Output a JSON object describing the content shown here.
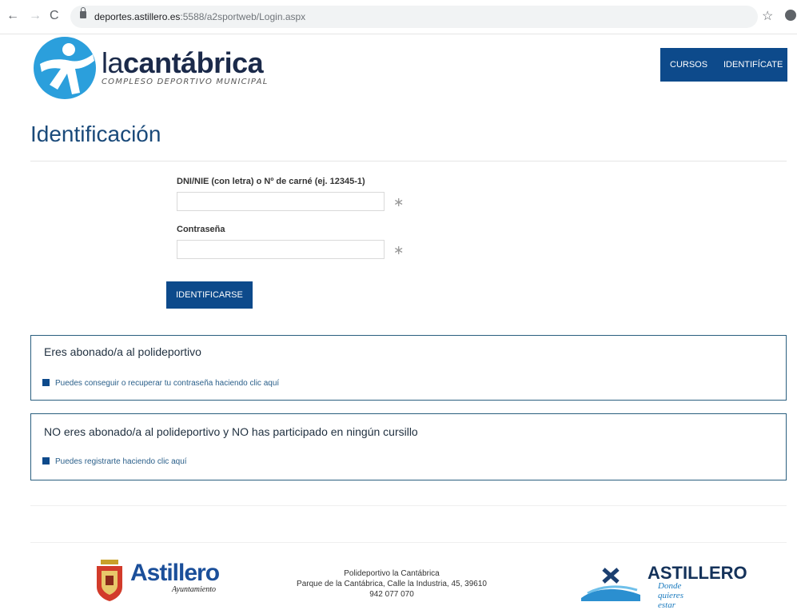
{
  "browser": {
    "url_host": "deportes.astillero.es",
    "url_path": ":5588/a2sportweb/Login.aspx"
  },
  "header": {
    "brand_prefix": "la",
    "brand_name": "cantábrica",
    "brand_subtitle": "COMPLESO DEPORTIVO MUNICIPAL",
    "nav": [
      "CURSOS",
      "IDENTIFÍCATE"
    ]
  },
  "page": {
    "title": "Identificación"
  },
  "form": {
    "user_label": "DNI/NIE (con letra) o Nº de carné (ej. 12345-1)",
    "user_value": "",
    "password_label": "Contraseña",
    "password_value": "",
    "required_mark": "∗",
    "submit_label": "IDENTIFICARSE"
  },
  "panels": [
    {
      "title": "Eres abonado/a al polideportivo",
      "link": "Puedes conseguir o recuperar tu contraseña haciendo clic aquí"
    },
    {
      "title": "NO eres abonado/a al polideportivo y NO has participado en ningún cursillo",
      "link": "Puedes registrarte haciendo clic aquí"
    }
  ],
  "footer": {
    "left_logo_text": "Astillero",
    "left_logo_sub": "Ayuntamiento",
    "address_lines": [
      "Polideportivo la Cantábrica",
      "Parque de la Cantábrica, Calle la Industria, 45, 39610",
      "942 077 070"
    ],
    "right_logo_text": "ASTILLERO",
    "right_logo_tagline": "Donde quieres estar"
  },
  "colors": {
    "primary": "#0d4a8b",
    "title": "#1a4a7a",
    "panel_border": "#2a5f7f",
    "logo_blue": "#2b9fdc"
  },
  "icons": [
    "back-arrow-icon",
    "forward-arrow-icon",
    "reload-icon",
    "lock-icon",
    "star-icon",
    "profile-icon"
  ]
}
